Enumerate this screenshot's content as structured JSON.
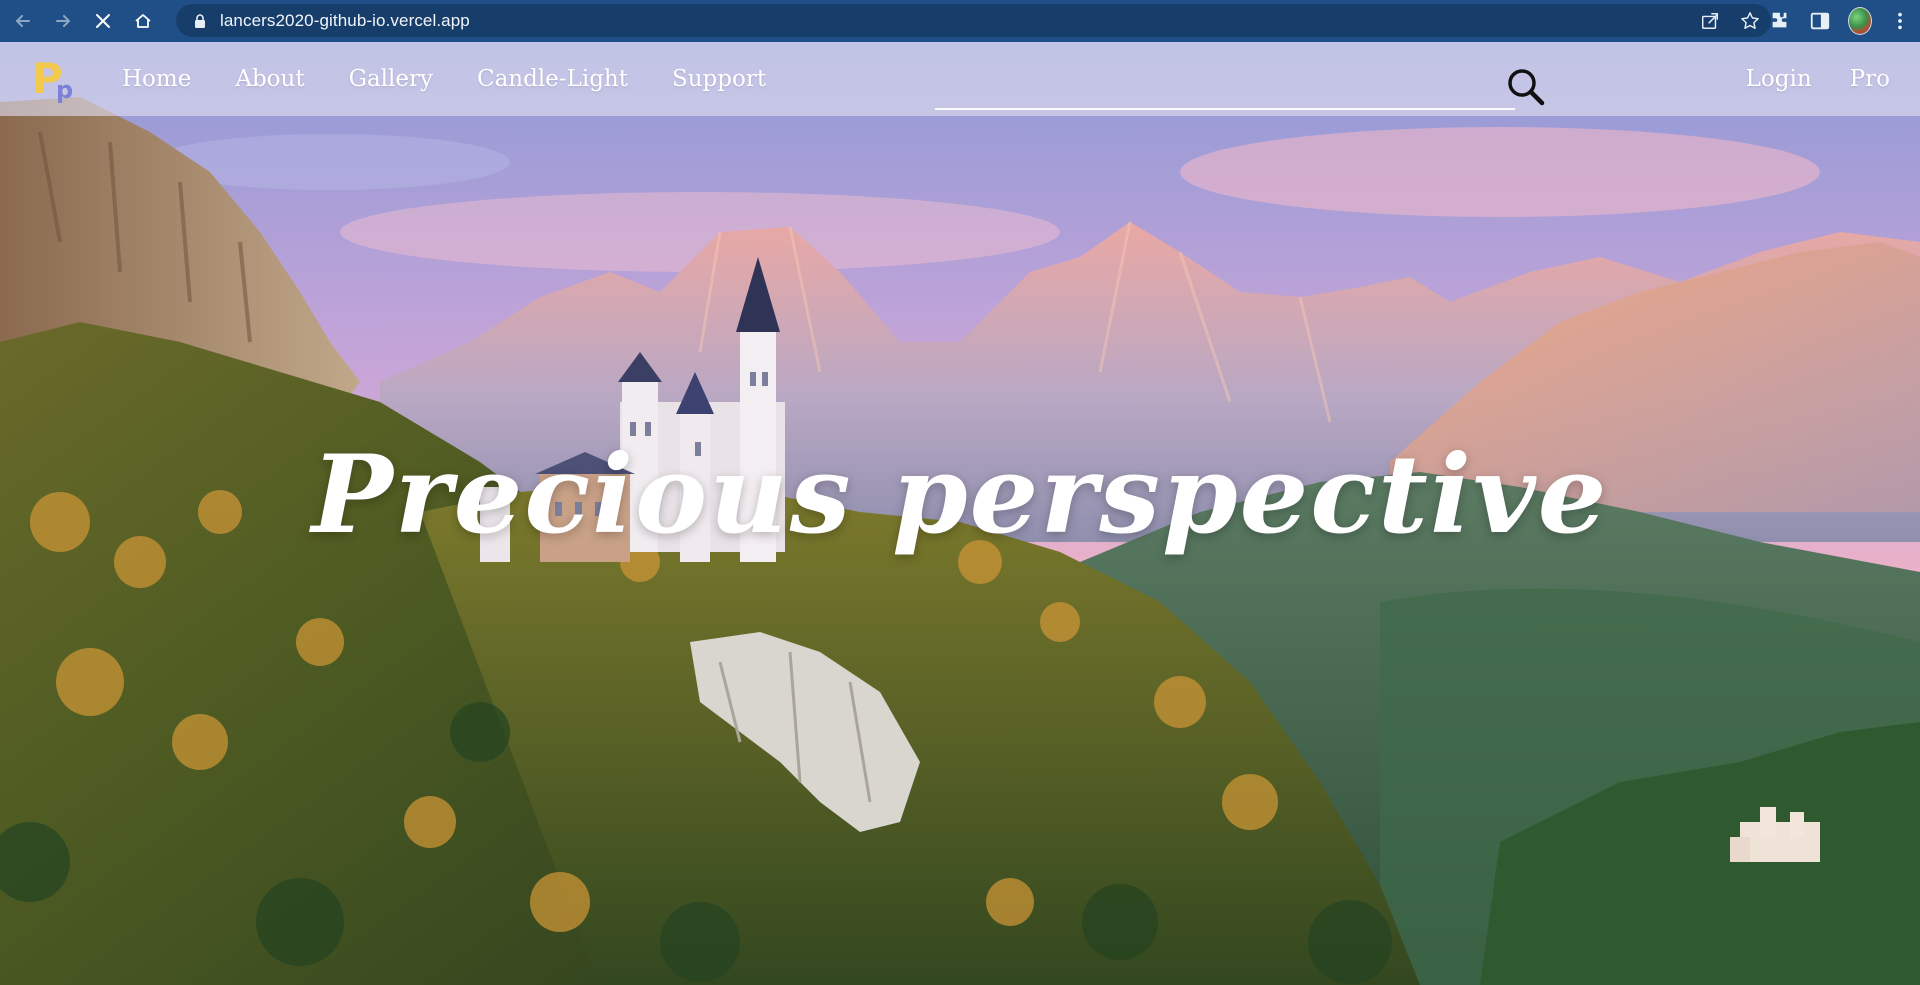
{
  "browser": {
    "url": "lancers2020-github-io.vercel.app",
    "buttons": [
      "back",
      "forward",
      "stop-loading",
      "home"
    ]
  },
  "site": {
    "logo": {
      "big": "P",
      "small": "p"
    },
    "nav": {
      "links": [
        "Home",
        "About",
        "Gallery",
        "Candle-Light",
        "Support"
      ],
      "search_placeholder": "",
      "login": "Login",
      "pro": "Pro"
    },
    "hero": {
      "title": "Precious perspective"
    }
  },
  "colors": {
    "chrome": "#1f4f86",
    "address_bar": "#173e6b",
    "logo_big": "#f3c94d",
    "logo_small": "#7c80d6",
    "nav_bg": "rgba(225,222,240,0.62)",
    "hero_text": "#ffffff"
  },
  "icons": {
    "back": "arrow-left-icon",
    "forward": "arrow-right-icon",
    "stop": "close-icon",
    "home": "home-icon",
    "lock": "lock-icon",
    "share": "share-icon",
    "bookmark": "star-icon",
    "extensions": "puzzle-icon",
    "side_panel": "side-panel-icon",
    "menu": "kebab-menu-icon",
    "search": "search-icon"
  }
}
